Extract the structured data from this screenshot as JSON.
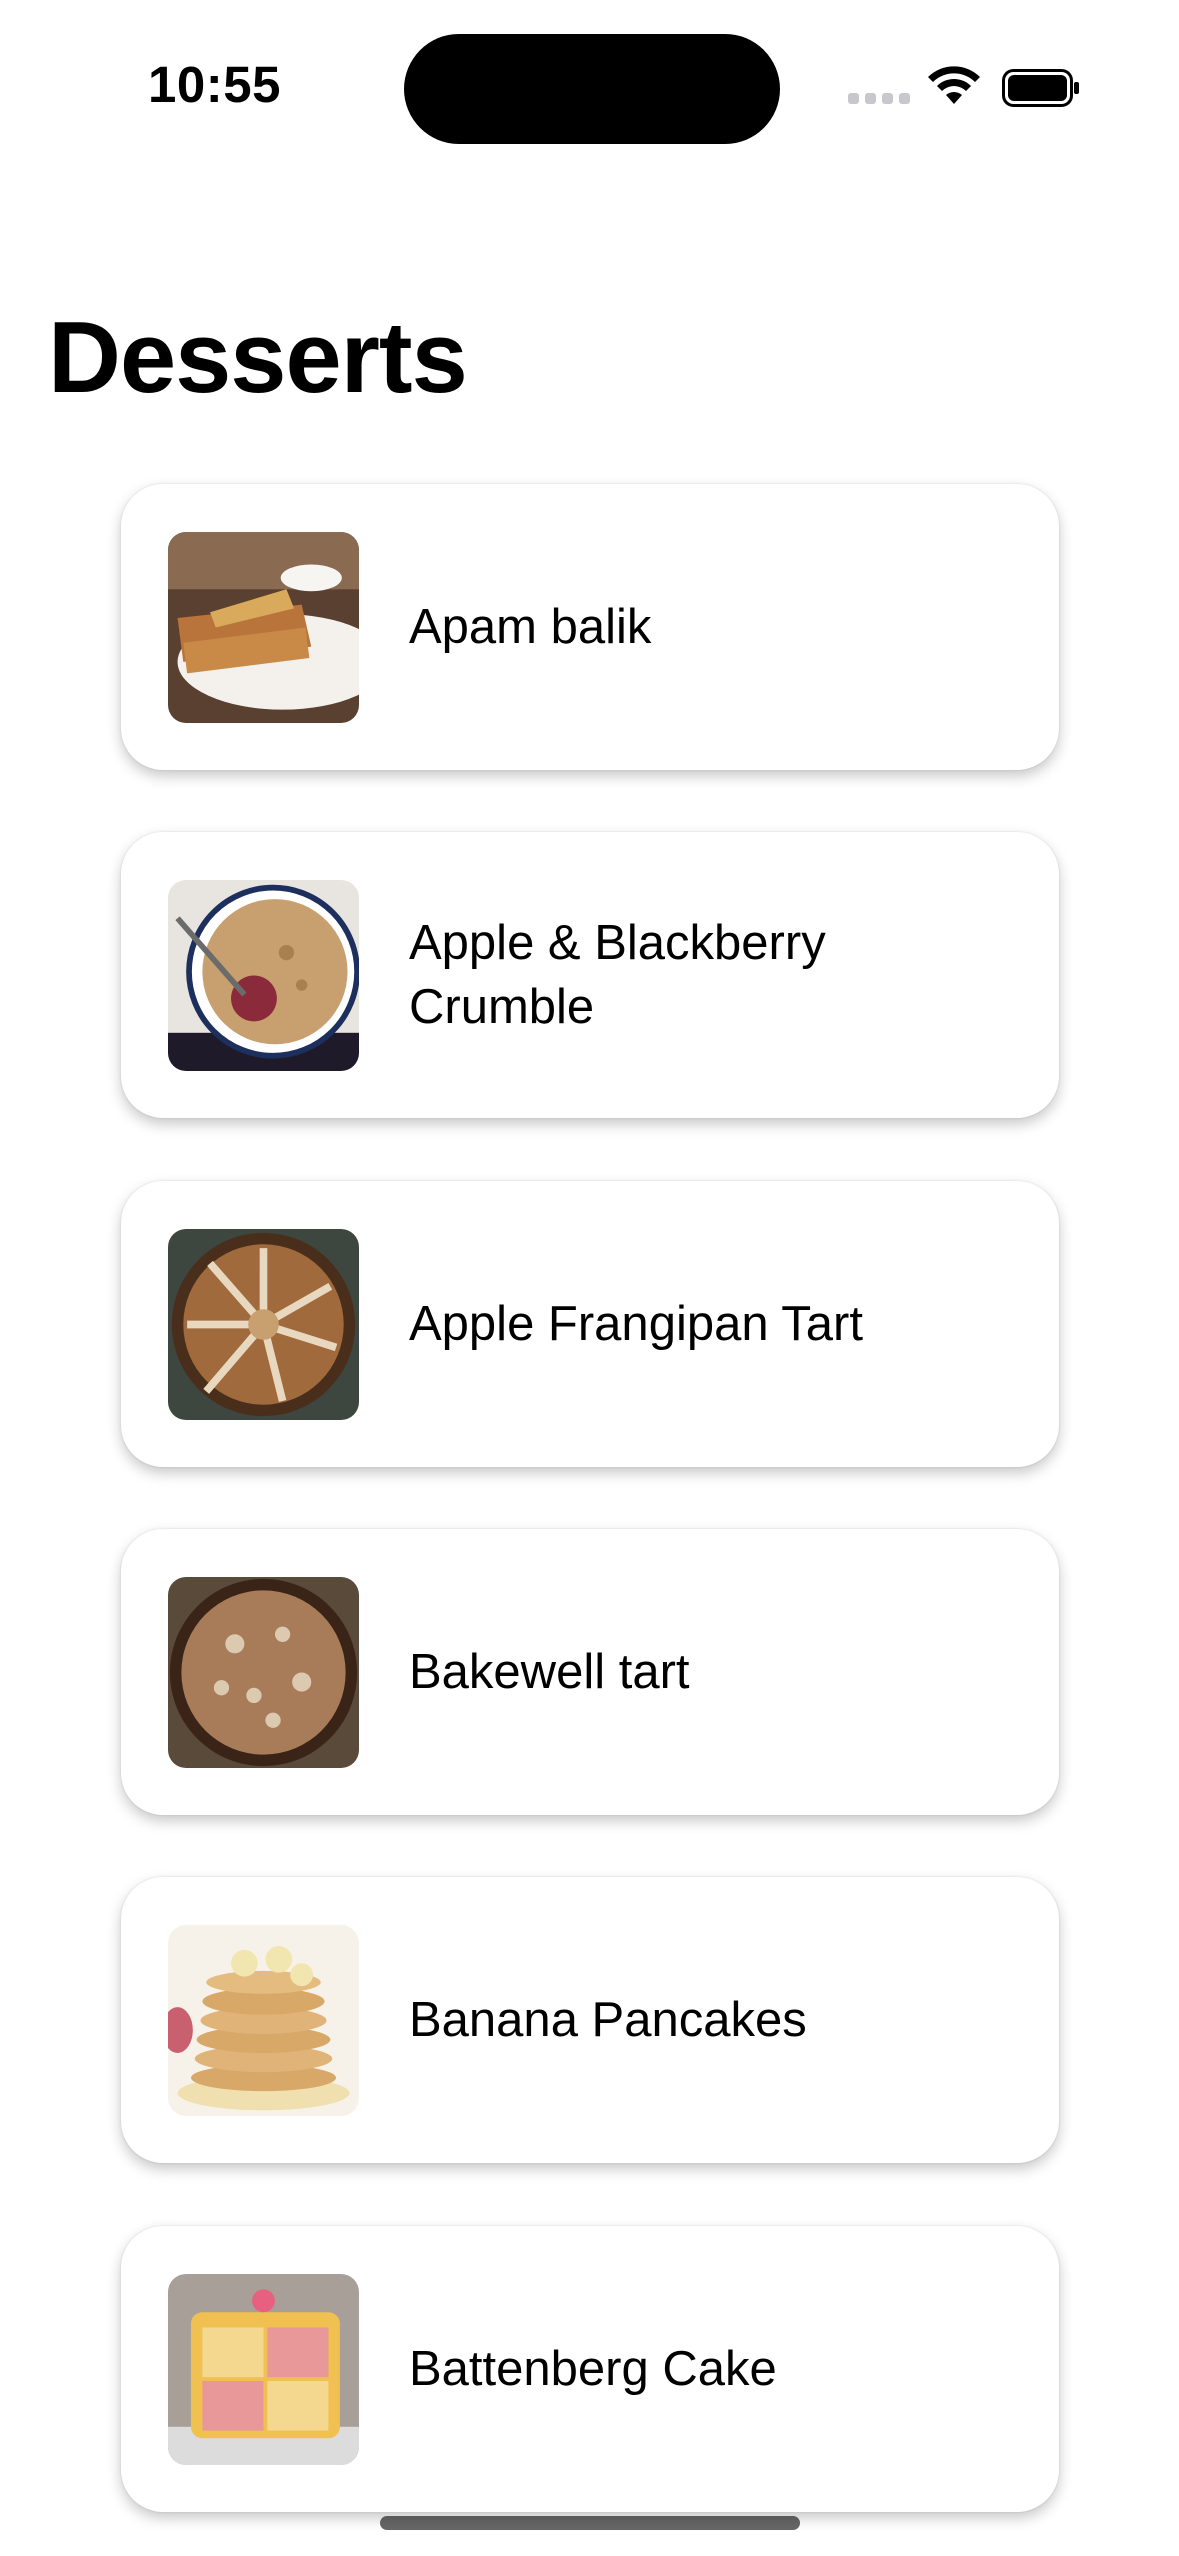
{
  "status_bar": {
    "time": "10:55"
  },
  "header": {
    "title": "Desserts"
  },
  "desserts": [
    {
      "name": "Apam balik",
      "thumbnail_icon": "apam-balik-photo"
    },
    {
      "name": "Apple & Blackberry Crumble",
      "thumbnail_icon": "crumble-photo"
    },
    {
      "name": "Apple Frangipan Tart",
      "thumbnail_icon": "frangipan-tart-photo"
    },
    {
      "name": "Bakewell tart",
      "thumbnail_icon": "bakewell-tart-photo"
    },
    {
      "name": "Banana Pancakes",
      "thumbnail_icon": "banana-pancakes-photo"
    },
    {
      "name": "Battenberg Cake",
      "thumbnail_icon": "battenberg-cake-photo"
    }
  ],
  "colors": {
    "background": "#ffffff",
    "text": "#000000",
    "card_shadow": "rgba(0,0,0,0.22)"
  }
}
